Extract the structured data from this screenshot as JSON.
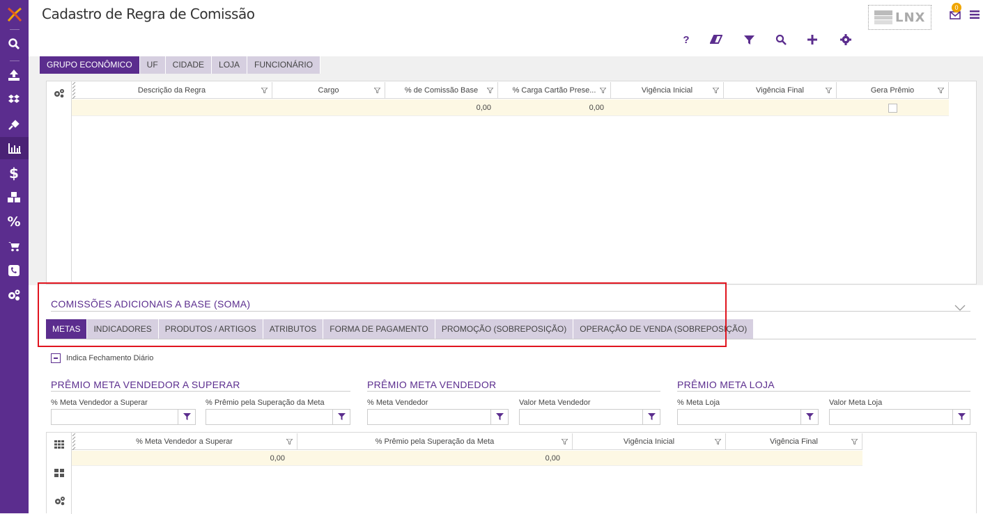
{
  "page": {
    "title": "Cadastro de Regra de Comissão",
    "brand_logo_text": "LNX",
    "notification_count": "0",
    "accent_color": "#5b2d8e",
    "highlight_color": "#e0141e"
  },
  "sidebar": {
    "items": [
      {
        "icon": "search-icon"
      },
      {
        "icon": "upload-icon"
      },
      {
        "icon": "dropbox-icon"
      },
      {
        "icon": "plug-icon"
      },
      {
        "icon": "bar-chart-icon"
      },
      {
        "icon": "dollar-icon"
      },
      {
        "icon": "cubes-icon"
      },
      {
        "icon": "percent-icon"
      },
      {
        "icon": "cart-icon"
      },
      {
        "icon": "phone-icon"
      },
      {
        "icon": "gears-icon"
      }
    ]
  },
  "toolbar": {
    "help": "?",
    "icons": [
      "help-icon",
      "eraser-icon",
      "filter-icon",
      "search-icon",
      "plus-icon",
      "gear-icon"
    ]
  },
  "top_tabs": [
    "GRUPO ECONÔMICO",
    "UF",
    "CIDADE",
    "LOJA",
    "FUNCIONÁRIO"
  ],
  "main_grid": {
    "columns": [
      "Descrição da Regra",
      "Cargo",
      "% de Comissão Base",
      "% Carga Cartão Prese...",
      "Vigência Inicial",
      "Vigência Final",
      "Gera Prêmio"
    ],
    "row": {
      "desc": "",
      "cargo": "",
      "comissao": "0,00",
      "carga": "0,00",
      "ini": "",
      "fim": "",
      "premio": ""
    }
  },
  "additional": {
    "section_title": "COMISSÕES ADICIONAIS A BASE (SOMA)",
    "tabs": [
      "METAS",
      "INDICADORES",
      "PRODUTOS / ARTIGOS",
      "ATRIBUTOS",
      "FORMA DE PAGAMENTO",
      "PROMOÇÃO (SOBREPOSIÇÃO)",
      "OPERAÇÃO DE VENDA (SOBREPOSIÇÃO)"
    ],
    "checkbox_label": "Indica Fechamento Diário"
  },
  "groups": {
    "g1": {
      "title": "PRÊMIO META VENDEDOR A SUPERAR",
      "f1": "% Meta Vendedor a Superar",
      "f2": "% Prêmio pela Superação da Meta"
    },
    "g2": {
      "title": "PRÊMIO META VENDEDOR",
      "f1": "% Meta Vendedor",
      "f2": "Valor Meta Vendedor"
    },
    "g3": {
      "title": "PRÊMIO META LOJA",
      "f1": "% Meta Loja",
      "f2": "Valor Meta Loja"
    }
  },
  "metas_grid": {
    "columns": [
      "% Meta Vendedor a Superar",
      "% Prêmio pela Superação da Meta",
      "Vigência Inicial",
      "Vigência Final"
    ],
    "row": {
      "c1": "0,00",
      "c2": "0,00",
      "c3": "",
      "c4": ""
    }
  }
}
